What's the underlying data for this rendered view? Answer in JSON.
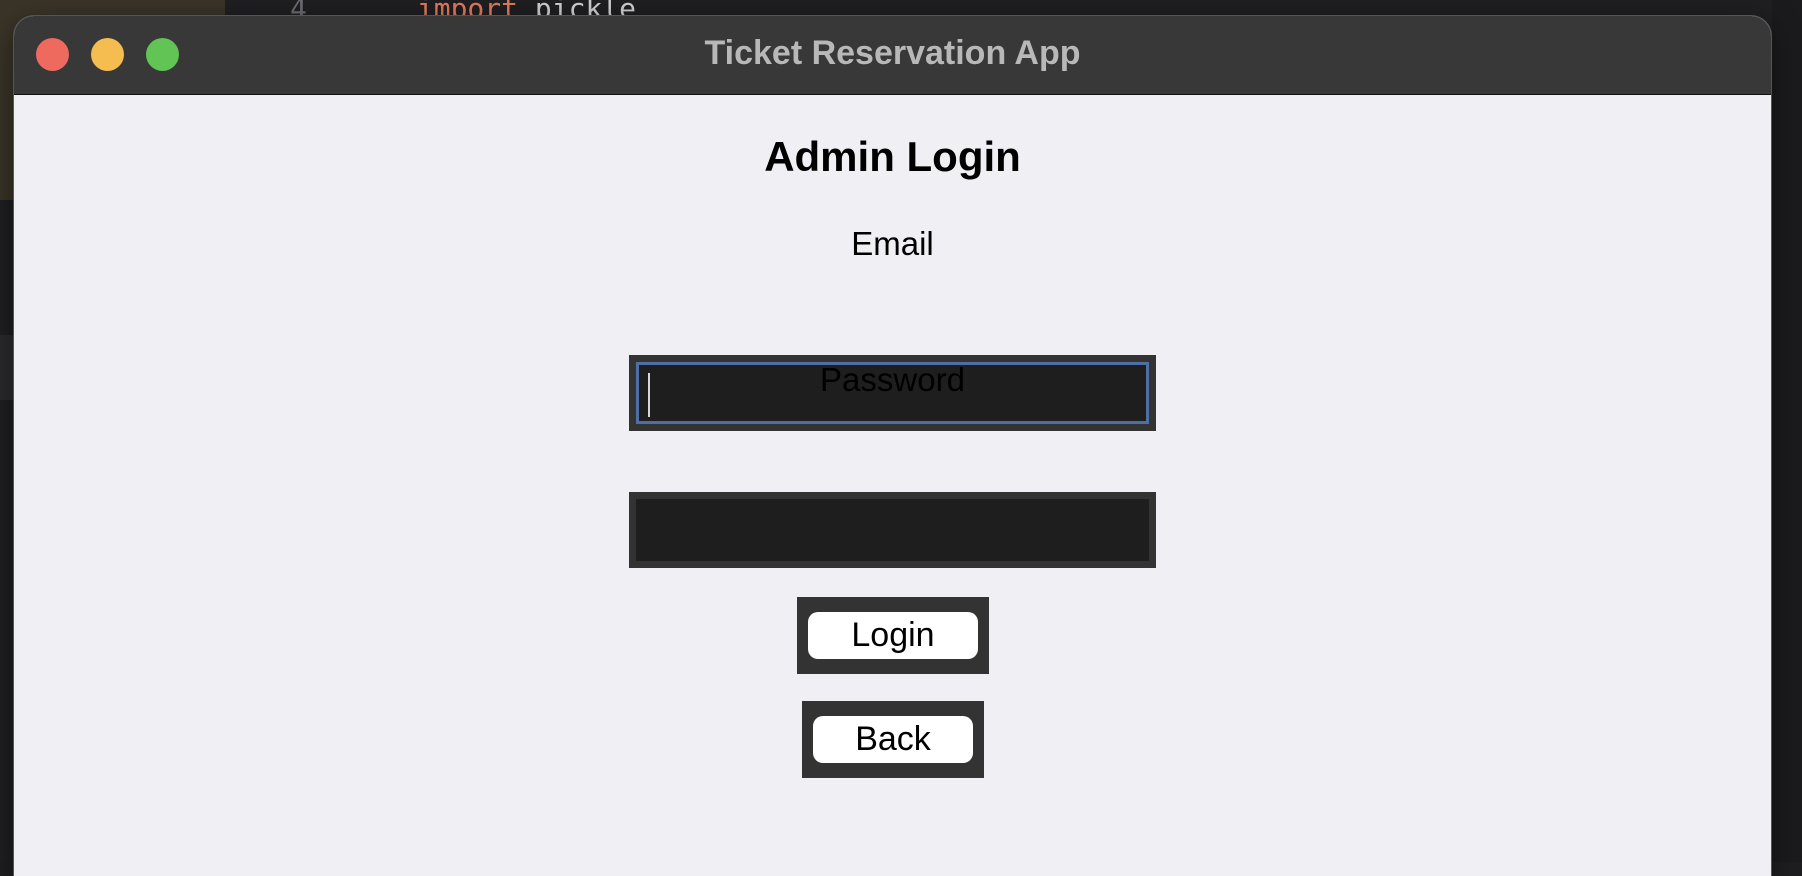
{
  "background": {
    "code_line_number": "4",
    "code_keyword": "import",
    "code_text": " pickle"
  },
  "window": {
    "title": "Ticket Reservation App",
    "controls": {
      "close_color": "#ee6a5f",
      "minimize_color": "#f5bd4f",
      "zoom_color": "#61c454"
    }
  },
  "form": {
    "heading": "Admin Login",
    "email": {
      "label": "Email",
      "value": "",
      "focused": true
    },
    "password": {
      "label": "Password",
      "value": ""
    },
    "login_button": "Login",
    "back_button": "Back"
  }
}
